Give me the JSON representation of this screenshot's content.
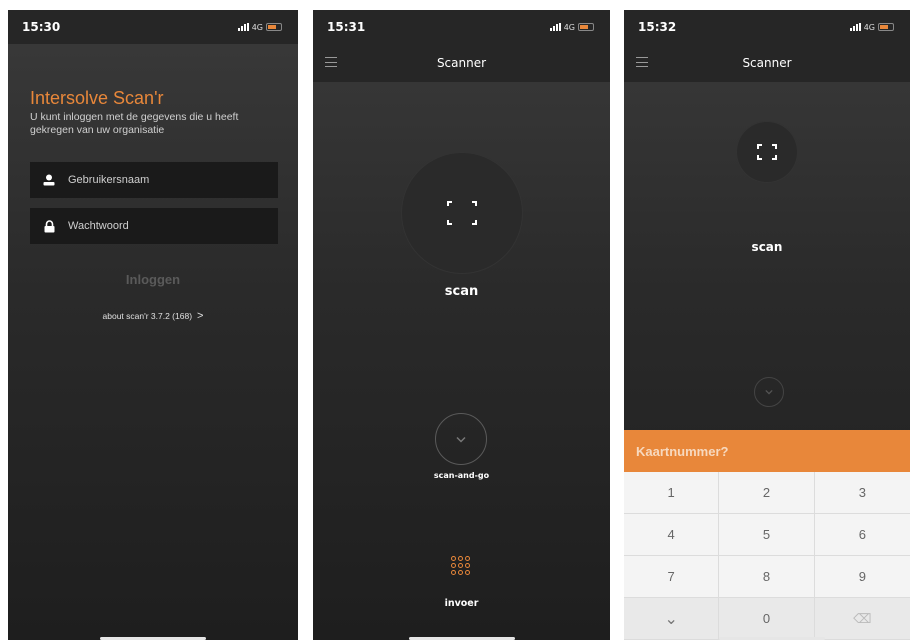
{
  "screens": [
    {
      "status": {
        "time": "15:30",
        "network": "4G"
      },
      "app_name": "Intersolve Scan'r",
      "subtitle": "U kunt inloggen met de gegevens die u heeft gekregen van uw organisatie",
      "username_placeholder": "Gebruikersnaam",
      "password_placeholder": "Wachtwoord",
      "login_label": "Inloggen",
      "about_label": "about scan'r 3.7.2 (168)",
      "about_chevron": ">",
      "icons": {
        "user": "user-icon",
        "lock": "lock-icon"
      }
    },
    {
      "status": {
        "time": "15:31",
        "network": "4G"
      },
      "title": "Scanner",
      "scan_label": "scan",
      "scan_and_go_label": "scan-and-go",
      "invoer_label": "invoer",
      "icons": {
        "menu": "hamburger-menu-icon",
        "scan": "scan-frame-icon",
        "check": "check-icon",
        "keypad": "keypad-icon"
      }
    },
    {
      "status": {
        "time": "15:32",
        "network": "4G"
      },
      "title": "Scanner",
      "scan_label": "scan",
      "input_placeholder": "Kaartnummer?",
      "keys": [
        "1",
        "2",
        "3",
        "4",
        "5",
        "6",
        "7",
        "8",
        "9",
        "⌄",
        "0",
        "⌫"
      ]
    }
  ],
  "colors": {
    "accent": "#e8873a",
    "background": "#2a2a2a",
    "keypad": "#f4f4f4"
  }
}
